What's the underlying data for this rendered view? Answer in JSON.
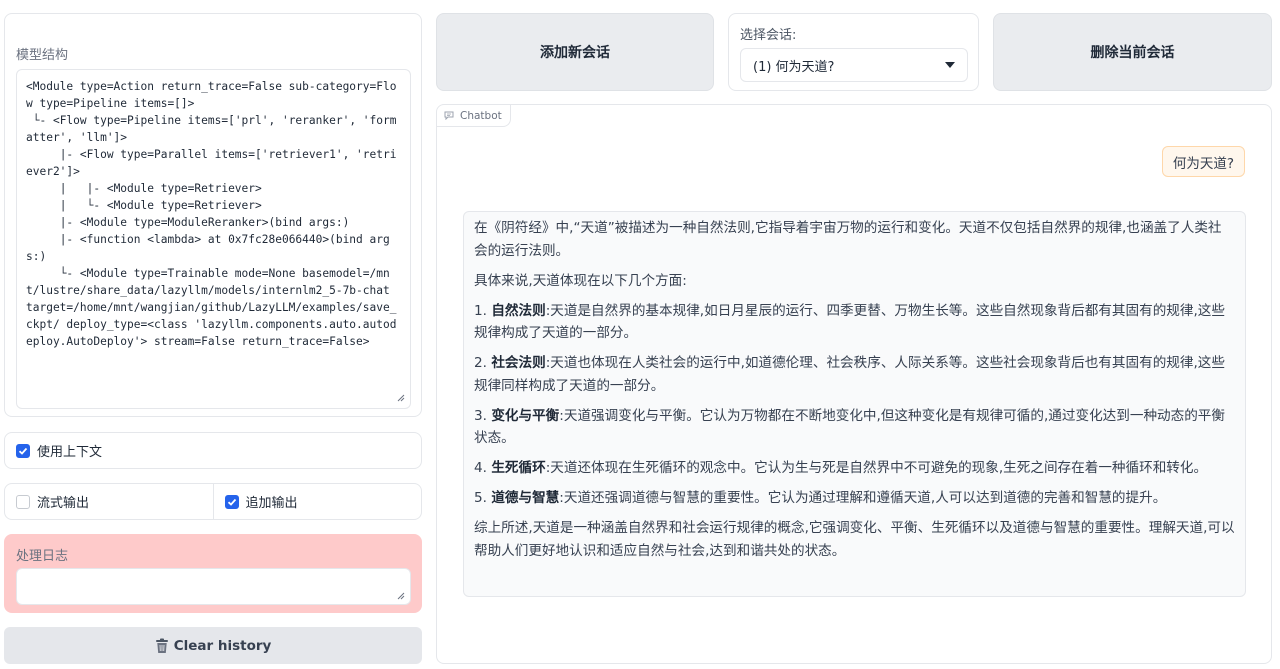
{
  "model_panel": {
    "label": "模型结构",
    "code": "<Module type=Action return_trace=False sub-category=Flow type=Pipeline items=[]>\n └- <Flow type=Pipeline items=['prl', 'reranker', 'formatter', 'llm']>\n     |- <Flow type=Parallel items=['retriever1', 'retriever2']>\n     |   |- <Module type=Retriever>\n     |   └- <Module type=Retriever>\n     |- <Module type=ModuleReranker>(bind args:)\n     |- <function <lambda> at 0x7fc28e066440>(bind args:)\n     └- <Module type=Trainable mode=None basemodel=/mnt/lustre/share_data/lazyllm/models/internlm2_5-7b-chat target=/home/mnt/wangjian/github/LazyLLM/examples/save_ckpt/ deploy_type=<class 'lazyllm.components.auto.autodeploy.AutoDeploy'> stream=False return_trace=False>"
  },
  "options": {
    "use_context": {
      "label": "使用上下文",
      "checked": true
    },
    "stream_output": {
      "label": "流式输出",
      "checked": false
    },
    "append_output": {
      "label": "追加输出",
      "checked": true
    }
  },
  "log_panel": {
    "label": "处理日志",
    "value": ""
  },
  "clear_button": {
    "label": "Clear history",
    "icon": "trash-icon"
  },
  "top": {
    "add_button": "添加新会话",
    "delete_button": "删除当前会话",
    "select_label": "选择会话:",
    "select_value": "(1)  何为天道?"
  },
  "chatbot": {
    "tag": "Chatbot",
    "user_message": "何为天道?",
    "bot": {
      "intro": "在《阴符经》中,“天道”被描述为一种自然法则,它指导着宇宙万物的运行和变化。天道不仅包括自然界的规律,也涵盖了人类社会的运行法则。",
      "lead": "具体来说,天道体现在以下几个方面:",
      "points": [
        {
          "num": "1.",
          "title": "自然法则",
          "text": ":天道是自然界的基本规律,如日月星辰的运行、四季更替、万物生长等。这些自然现象背后都有其固有的规律,这些规律构成了天道的一部分。"
        },
        {
          "num": "2.",
          "title": "社会法则",
          "text": ":天道也体现在人类社会的运行中,如道德伦理、社会秩序、人际关系等。这些社会现象背后也有其固有的规律,这些规律同样构成了天道的一部分。"
        },
        {
          "num": "3.",
          "title": "变化与平衡",
          "text": ":天道强调变化与平衡。它认为万物都在不断地变化中,但这种变化是有规律可循的,通过变化达到一种动态的平衡状态。"
        },
        {
          "num": "4.",
          "title": "生死循环",
          "text": ":天道还体现在生死循环的观念中。它认为生与死是自然界中不可避免的现象,生死之间存在着一种循环和转化。"
        },
        {
          "num": "5.",
          "title": "道德与智慧",
          "text": ":天道还强调道德与智慧的重要性。它认为通过理解和遵循天道,人可以达到道德的完善和智慧的提升。"
        }
      ],
      "conclusion": "综上所述,天道是一种涵盖自然界和社会运行规律的概念,它强调变化、平衡、生死循环以及道德与智慧的重要性。理解天道,可以帮助人们更好地认识和适应自然与社会,达到和谐共处的状态。"
    }
  },
  "colors": {
    "accent": "#2563eb",
    "log_bg": "#fecaca",
    "user_bubble": "#fff7ed",
    "bot_bubble": "#f9fafb"
  }
}
